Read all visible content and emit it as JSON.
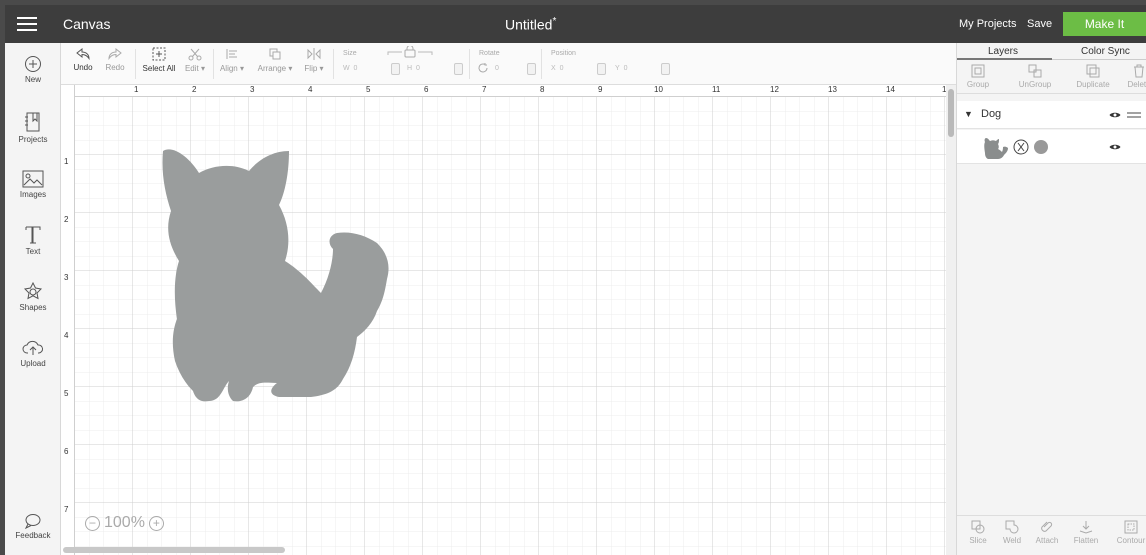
{
  "header": {
    "app_title": "Canvas",
    "doc_title": "Untitled",
    "doc_modified_mark": "*",
    "my_projects": "My Projects",
    "save": "Save",
    "make_it": "Make It"
  },
  "sidebar": {
    "items": [
      {
        "label": "New",
        "icon": "plus-circle-icon"
      },
      {
        "label": "Projects",
        "icon": "projects-icon"
      },
      {
        "label": "Images",
        "icon": "image-icon"
      },
      {
        "label": "Text",
        "icon": "text-icon"
      },
      {
        "label": "Shapes",
        "icon": "shapes-icon"
      },
      {
        "label": "Upload",
        "icon": "upload-icon"
      }
    ],
    "feedback": "Feedback"
  },
  "toolbar": {
    "undo": "Undo",
    "redo": "Redo",
    "select_all": "Select All",
    "edit": "Edit",
    "align": "Align",
    "arrange": "Arrange",
    "flip": "Flip",
    "size_label": "Size",
    "w_label": "W",
    "w_value": "0",
    "h_label": "H",
    "h_value": "0",
    "rotate_label": "Rotate",
    "rotate_value": "0",
    "position_label": "Position",
    "x_label": "X",
    "x_value": "0",
    "y_label": "Y",
    "y_value": "0"
  },
  "canvas": {
    "h_ruler": [
      "1",
      "2",
      "3",
      "4",
      "5",
      "6",
      "7",
      "8",
      "9",
      "10",
      "11",
      "12",
      "13",
      "14",
      "1"
    ],
    "v_ruler": [
      "1",
      "2",
      "3",
      "4",
      "5",
      "6",
      "7"
    ],
    "zoom_level": "100%",
    "shape_fill": "#9a9d9d"
  },
  "layers_panel": {
    "tabs": [
      "Layers",
      "Color Sync"
    ],
    "tools": [
      "Group",
      "UnGroup",
      "Duplicate",
      "Delete"
    ],
    "group_name": "Dog",
    "bottom_tools": [
      "Slice",
      "Weld",
      "Attach",
      "Flatten",
      "Contour"
    ]
  },
  "colors": {
    "make_it": "#6cbd45",
    "top_bar": "#3d3d3d",
    "shape": "#9a9d9d"
  }
}
